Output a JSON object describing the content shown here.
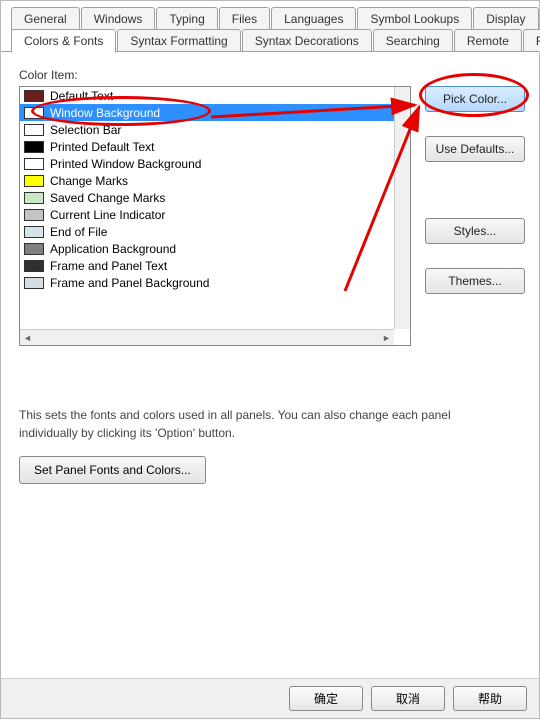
{
  "tabs_row1": [
    {
      "label": "General"
    },
    {
      "label": "Windows"
    },
    {
      "label": "Typing"
    },
    {
      "label": "Files"
    },
    {
      "label": "Languages"
    },
    {
      "label": "Symbol Lookups"
    },
    {
      "label": "Display"
    }
  ],
  "tabs_row2": [
    {
      "label": "Colors & Fonts",
      "active": true
    },
    {
      "label": "Syntax Formatting"
    },
    {
      "label": "Syntax Decorations"
    },
    {
      "label": "Searching"
    },
    {
      "label": "Remote"
    },
    {
      "label": "Folders"
    }
  ],
  "section_label": "Color Item:",
  "color_items": [
    {
      "label": "Default Text",
      "color": "#6b1e1e"
    },
    {
      "label": "Window Background",
      "color": "#ffffff",
      "selected": true
    },
    {
      "label": "Selection Bar",
      "color": "#ffffff"
    },
    {
      "label": "Printed Default Text",
      "color": "#000000"
    },
    {
      "label": "Printed Window Background",
      "color": "#ffffff"
    },
    {
      "label": "Change Marks",
      "color": "#ffff00"
    },
    {
      "label": "Saved Change Marks",
      "color": "#c8e8c8"
    },
    {
      "label": "Current Line Indicator",
      "color": "#c4c4c4"
    },
    {
      "label": "End of File",
      "color": "#d6e4ea"
    },
    {
      "label": "Application Background",
      "color": "#808080"
    },
    {
      "label": "Frame and Panel Text",
      "color": "#303030"
    },
    {
      "label": "Frame and Panel Background",
      "color": "#d6dee4"
    }
  ],
  "buttons": {
    "pick_color": "Pick Color...",
    "use_defaults": "Use Defaults...",
    "styles": "Styles...",
    "themes": "Themes..."
  },
  "description": "This sets the fonts and colors used in all panels. You can also change each panel individually by clicking its 'Option' button.",
  "panel_button": "Set Panel Fonts and Colors...",
  "bottom": {
    "ok": "确定",
    "cancel": "取消",
    "help": "帮助"
  }
}
